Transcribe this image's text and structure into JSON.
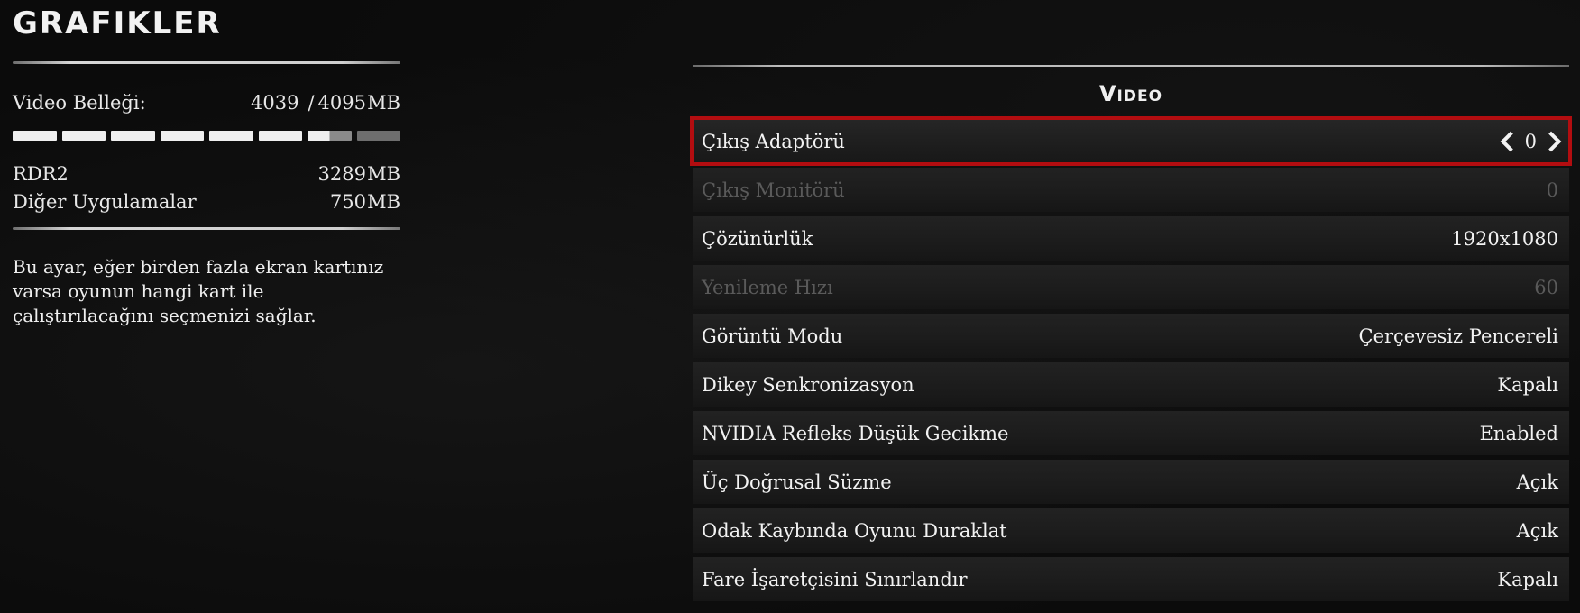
{
  "page": {
    "title": "GRAFIKLER"
  },
  "memory": {
    "label": "Video Belleği:",
    "used": "4039",
    "separator": "/",
    "total": "4095",
    "unit": "MB",
    "usage_fraction": 0.986,
    "bar_segments": [
      "full",
      "full",
      "full",
      "full",
      "full",
      "full",
      "half",
      "empty"
    ],
    "items": [
      {
        "label": "RDR2",
        "value": "3289",
        "unit": "MB"
      },
      {
        "label": "Diğer Uygulamalar",
        "value": "750",
        "unit": "MB"
      }
    ]
  },
  "description": "Bu ayar, eğer birden fazla ekran kartınız varsa oyunun hangi kart ile çalıştırılacağını seçmenizi sağlar.",
  "section": {
    "title": "Video"
  },
  "settings": [
    {
      "label": "Çıkış Adaptörü",
      "value": "0",
      "state": "selected",
      "arrows": true
    },
    {
      "label": "Çıkış Monitörü",
      "value": "0",
      "state": "disabled"
    },
    {
      "label": "Çözünürlük",
      "value": "1920x1080",
      "state": "normal"
    },
    {
      "label": "Yenileme Hızı",
      "value": "60",
      "state": "disabled"
    },
    {
      "label": "Görüntü Modu",
      "value": "Çerçevesiz Pencereli",
      "state": "normal"
    },
    {
      "label": "Dikey Senkronizasyon",
      "value": "Kapalı",
      "state": "normal"
    },
    {
      "label": "NVIDIA Refleks Düşük Gecikme",
      "value": "Enabled",
      "state": "normal"
    },
    {
      "label": "Üç Doğrusal Süzme",
      "value": "Açık",
      "state": "normal"
    },
    {
      "label": "Odak Kaybında Oyunu Duraklat",
      "value": "Açık",
      "state": "normal"
    },
    {
      "label": "Fare İşaretçisini Sınırlandır",
      "value": "Kapalı",
      "state": "normal"
    }
  ],
  "colors": {
    "selection": "#b30d10",
    "background": "#0b0b0b",
    "disabled_text": "#5a5a5a"
  }
}
